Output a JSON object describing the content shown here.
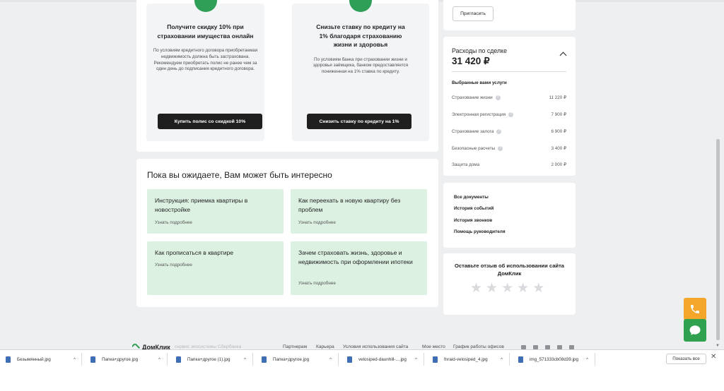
{
  "offers": [
    {
      "title": "Получите скидку 10% при страховании имущества онлайн",
      "text": "По условиям кредитного договора приобретаемая недвижимость должна быть застрахована. Рекомендуем приобретать полис не ранее чем за один день до подписания кредитного договора.",
      "button": "Купить полис со скидкой 10%"
    },
    {
      "title": "Снизьте ставку по кредиту на 1% благодаря страхованию жизни и здоровья",
      "text": "По условиям банка при страховании жизни и здоровья заёмщика, банком предоставляется пониженная на 1% ставка по кредиту.",
      "button": "Снизить ставку по кредиту на 1%"
    }
  ],
  "interest": {
    "title": "Пока вы ожидаете, Вам может быть интересно",
    "tiles": [
      {
        "title": "Инструкция: приемка квартиры в новостройке",
        "more": "Узнать подробнее"
      },
      {
        "title": "Как переехать в новую квартиру без проблем",
        "more": "Узнать подробнее"
      },
      {
        "title": "Как прописаться в квартире",
        "more": "Узнать подробнее"
      },
      {
        "title": "Зачем страховать жизнь, здоровье и недвижимость при оформлении ипотеки",
        "more": "Узнать подробнее"
      }
    ]
  },
  "invite": {
    "button": "Пригласить"
  },
  "expenses": {
    "title": "Расходы по сделке",
    "amount": "31 420 ₽",
    "selected_label": "Выбранные вами услуги",
    "items": [
      {
        "name": "Страхование жизни",
        "value": "11 220 ₽",
        "info": true
      },
      {
        "name": "Электронная регистрация",
        "value": "7 900 ₽",
        "info": true
      },
      {
        "name": "Страхование залога",
        "value": "6 900 ₽",
        "info": true
      },
      {
        "name": "Безопасные расчеты",
        "value": "3 400 ₽",
        "info": true
      },
      {
        "name": "Защита дома",
        "value": "2 000 ₽",
        "info": false
      }
    ]
  },
  "links": [
    "Все документы",
    "История событий",
    "История звонков",
    "Помощь руководителя"
  ],
  "feedback": {
    "text": "Оставьте отзыв об использовании сайта ДомКлик",
    "rating": 0,
    "max": 5
  },
  "footer": {
    "logo": "ДомКлик",
    "tagline": "сервис экосистемы Сбербанка",
    "links": [
      "Партнерам",
      "Карьера",
      "Условия использования сайта",
      "Мое место",
      "График работы офисов"
    ]
  },
  "downloads": {
    "files": [
      "Безымянный.jpg",
      "Папка+другое.jpg",
      "Папка+другое (1).jpg",
      "Папка+другое.jpg",
      "velosiped-daunhill-....jpg",
      "fnraid-velosiped_4.jpg",
      "img_571333cb08d39.jpg"
    ],
    "show_all": "Показать все"
  },
  "colors": {
    "accent_green": "#2f9e56",
    "tile_green": "#ddf1e3",
    "button_dark": "#1f1f1f",
    "phone_fab": "#f4a62a",
    "chat_fab": "#2fa14f"
  }
}
